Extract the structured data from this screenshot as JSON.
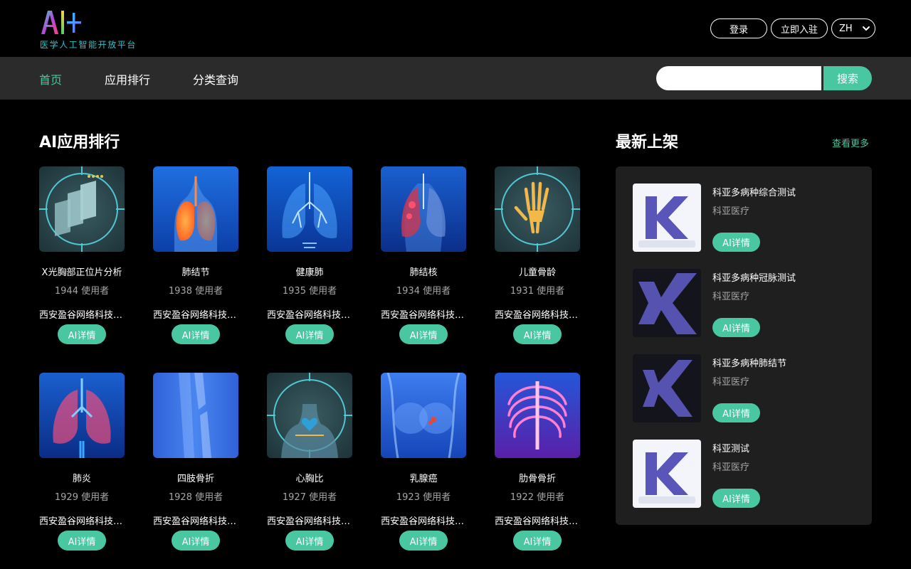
{
  "brand": {
    "logo_text": "AI+",
    "subtitle": "医学人工智能开放平台"
  },
  "auth": {
    "login_label": "登录",
    "join_label": "立即入驻",
    "language": "ZH"
  },
  "nav": {
    "items": [
      {
        "label": "首页",
        "active": true
      },
      {
        "label": "应用排行",
        "active": false
      },
      {
        "label": "分类查询",
        "active": false
      }
    ],
    "search_placeholder": "",
    "search_label": "搜索"
  },
  "ranking": {
    "title": "AI应用排行",
    "detail_label": "AI详情",
    "apps": [
      {
        "name": "X光胸部正位片分析",
        "users": "1944 使用者",
        "vendor": "西安盈谷网络科技有限公司",
        "icon": "xray-films-icon"
      },
      {
        "name": "肺结节",
        "users": "1938 使用者",
        "vendor": "西安盈谷网络科技有限公司",
        "icon": "lung-torso-icon"
      },
      {
        "name": "健康肺",
        "users": "1935 使用者",
        "vendor": "西安盈谷网络科技有限公司",
        "icon": "healthy-lung-icon"
      },
      {
        "name": "肺结核",
        "users": "1934 使用者",
        "vendor": "西安盈谷网络科技有限公司",
        "icon": "tb-lung-icon"
      },
      {
        "name": "儿童骨龄",
        "users": "1931 使用者",
        "vendor": "西安盈谷网络科技有限公司",
        "icon": "hand-bone-icon"
      },
      {
        "name": "肺炎",
        "users": "1929 使用者",
        "vendor": "西安盈谷网络科技有限公司",
        "icon": "pneumonia-lung-icon"
      },
      {
        "name": "四肢骨折",
        "users": "1928 使用者",
        "vendor": "西安盈谷网络科技有限公司",
        "icon": "limb-fracture-icon"
      },
      {
        "name": "心胸比",
        "users": "1927 使用者",
        "vendor": "西安盈谷网络科技有限公司",
        "icon": "heart-chest-icon"
      },
      {
        "name": "乳腺癌",
        "users": "1923 使用者",
        "vendor": "西安盈谷网络科技有限公司",
        "icon": "breast-cancer-icon"
      },
      {
        "name": "肋骨骨折",
        "users": "1922 使用者",
        "vendor": "西安盈谷网络科技有限公司",
        "icon": "ribcage-icon"
      }
    ]
  },
  "latest": {
    "title": "最新上架",
    "more_label": "查看更多",
    "detail_label": "AI详情",
    "items": [
      {
        "name": "科亚多病种综合测试",
        "vendor": "科亚医疗",
        "icon": "keya-logo-light-icon"
      },
      {
        "name": "科亚多病种冠脉测试",
        "vendor": "科亚医疗",
        "icon": "keya-logo-dark-icon"
      },
      {
        "name": "科亚多病种肺结节",
        "vendor": "科亚医疗",
        "icon": "keya-logo-dark-icon"
      },
      {
        "name": "科亚测试",
        "vendor": "科亚医疗",
        "icon": "keya-logo-light-icon"
      }
    ]
  },
  "colors": {
    "accent": "#48c7a0",
    "navbar_bg": "#2b2b2b",
    "panel_bg": "#1f1f1f",
    "muted_text": "#a6a6a6"
  }
}
